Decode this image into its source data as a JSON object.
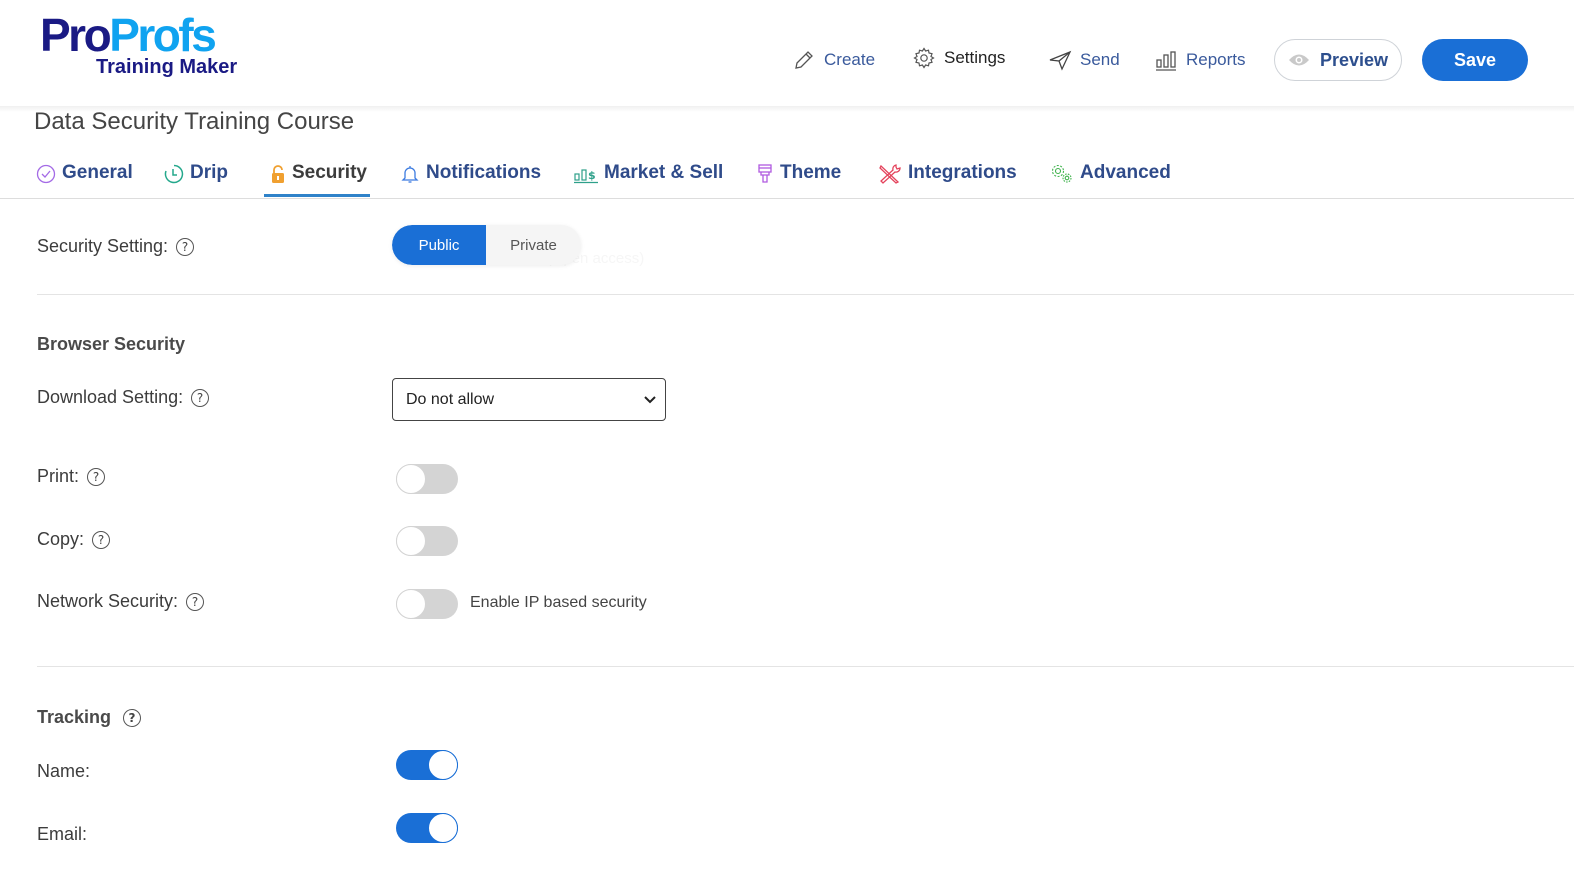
{
  "app": {
    "logo_primary_a": "Pro",
    "logo_primary_b": "Profs",
    "logo_secondary": "Training Maker",
    "colors": {
      "brand_dark": "#1a1a84",
      "brand_light": "#10a3f0",
      "accent": "#1a6fd6"
    }
  },
  "topnav": {
    "create": {
      "label": "Create",
      "icon": "pencil-icon"
    },
    "settings": {
      "label": "Settings",
      "icon": "gear-icon"
    },
    "send": {
      "label": "Send",
      "icon": "paper-plane-icon"
    },
    "reports": {
      "label": "Reports",
      "icon": "bar-chart-icon"
    },
    "preview": {
      "label": "Preview",
      "icon": "eye-icon"
    },
    "save": {
      "label": "Save"
    }
  },
  "course": {
    "title": "Data Security Training Course"
  },
  "tabs": [
    {
      "label": "General",
      "icon": "check-circle-icon",
      "active": false
    },
    {
      "label": "Drip",
      "icon": "clock-icon",
      "active": false
    },
    {
      "label": "Security",
      "icon": "lock-icon",
      "active": true
    },
    {
      "label": "Notifications",
      "icon": "bell-icon",
      "active": false
    },
    {
      "label": "Market & Sell",
      "icon": "market-icon",
      "active": false
    },
    {
      "label": "Theme",
      "icon": "paintbrush-icon",
      "active": false
    },
    {
      "label": "Integrations",
      "icon": "tools-icon",
      "active": false
    },
    {
      "label": "Advanced",
      "icon": "gears-icon",
      "active": false
    }
  ],
  "security": {
    "setting_label": "Security Setting:",
    "options": [
      "Public",
      "Private"
    ],
    "selected": "Public",
    "ghost_text": "the web (Open access)"
  },
  "browser_security": {
    "title": "Browser Security",
    "download": {
      "label": "Download Setting:",
      "value": "Do not allow"
    },
    "print": {
      "label": "Print:",
      "enabled": false
    },
    "copy": {
      "label": "Copy:",
      "enabled": false
    },
    "network": {
      "label": "Network Security:",
      "enabled": false,
      "text": "Enable IP based security"
    }
  },
  "tracking": {
    "title": "Tracking",
    "name": {
      "label": "Name:",
      "enabled": true
    },
    "email": {
      "label": "Email:",
      "enabled": true
    }
  },
  "help_glyph": "?"
}
